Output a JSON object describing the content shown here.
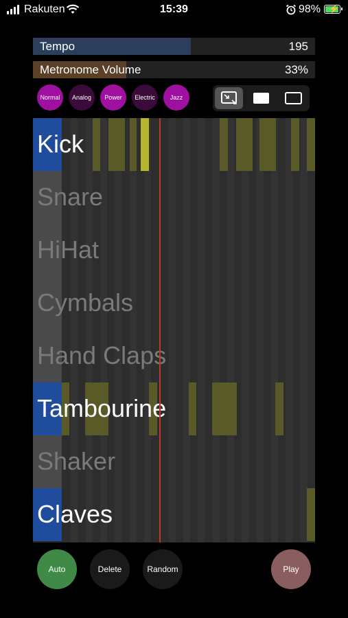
{
  "status_bar": {
    "carrier": "Rakuten",
    "time": "15:39",
    "battery": "98%",
    "battery_level": 0.98
  },
  "controls": {
    "tempo": {
      "label": "Tempo",
      "value": "195",
      "fill_fraction": 0.56
    },
    "metronome_volume": {
      "label": "Metronome Volume",
      "value": "33%",
      "fill_fraction": 0.33
    }
  },
  "kits": [
    {
      "label": "Normal",
      "color": "#a010a0"
    },
    {
      "label": "Analog",
      "color": "#3a0a3a"
    },
    {
      "label": "Power",
      "color": "#a010a0"
    },
    {
      "label": "Electric",
      "color": "#3a0a3a"
    },
    {
      "label": "Jazz",
      "color": "#a010a0"
    }
  ],
  "view_modes": [
    {
      "icon": "zoom-fit-icon",
      "selected": true
    },
    {
      "icon": "filled-rect-icon",
      "selected": false
    },
    {
      "icon": "outline-rect-icon",
      "selected": false
    }
  ],
  "tracks": [
    {
      "name": "Kick",
      "active": true
    },
    {
      "name": "Snare",
      "active": false
    },
    {
      "name": "HiHat",
      "active": false
    },
    {
      "name": "Cymbals",
      "active": false
    },
    {
      "name": "Hand Claps",
      "active": false
    },
    {
      "name": "Tambourine",
      "active": true
    },
    {
      "name": "Shaker",
      "active": false
    },
    {
      "name": "Claves",
      "active": true
    }
  ],
  "buttons": {
    "auto": "Auto",
    "delete": "Delete",
    "random": "Random",
    "play": "Play"
  },
  "colors": {
    "active_track": "#1f4c9c",
    "inactive_track": "#4a4a4a",
    "note": "#5a5a28",
    "note_highlight": "#b5b52e",
    "tempo_fill": "#2b3f5c",
    "volume_fill": "#5a4026",
    "playhead": "#c0352e",
    "auto_button": "#3e8a46",
    "control_button": "#1a1a1a",
    "play_button": "#8a5e61"
  }
}
